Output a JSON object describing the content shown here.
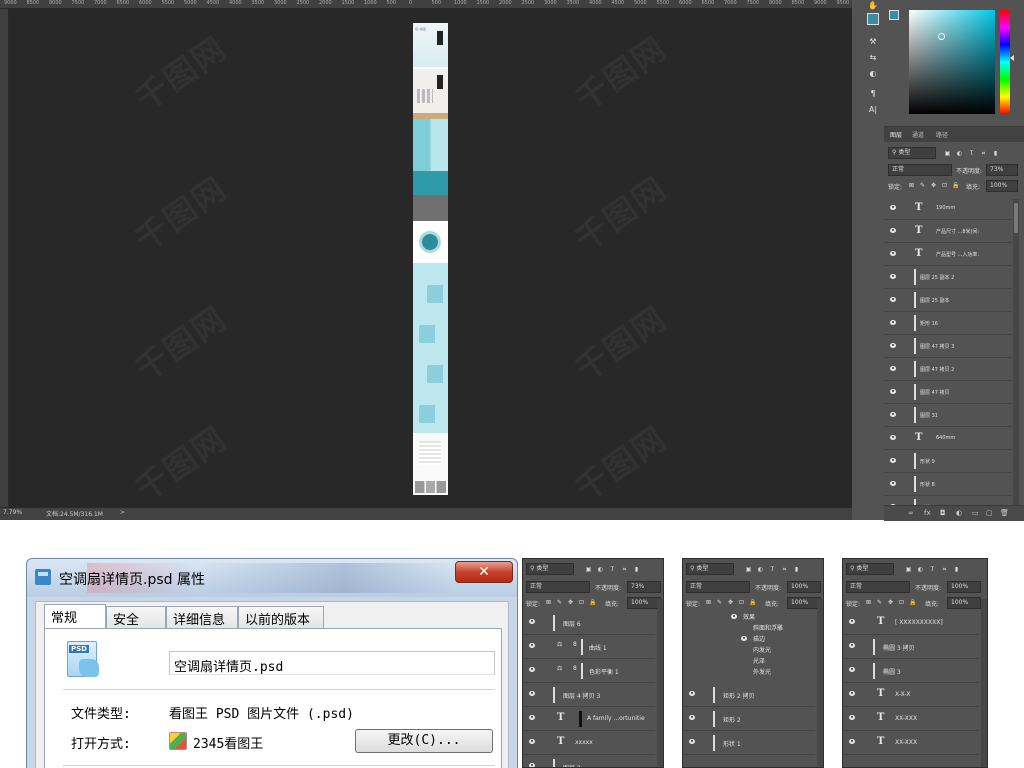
{
  "photoshop": {
    "ruler_ticks": [
      "9000",
      "8500",
      "8000",
      "7500",
      "7000",
      "6500",
      "6000",
      "5500",
      "5000",
      "4500",
      "4000",
      "3500",
      "3000",
      "2500",
      "2000",
      "1500",
      "1000",
      "500",
      "0",
      "500",
      "1000",
      "1500",
      "2000",
      "2500",
      "3000",
      "3500",
      "4000",
      "4500",
      "5000",
      "5500",
      "6000",
      "6500",
      "7000",
      "7500",
      "8000",
      "8500",
      "9000",
      "9500"
    ],
    "status": {
      "zoom": "7.79%",
      "doc_info": "文档:24.5M/316.1M",
      "arrow": ">"
    },
    "watermark": "千图网",
    "document": {
      "text_samples": [
        "色•恒温",
        "品牌介绍",
        "产品展示"
      ]
    },
    "tool_icons": [
      "hand-tool-icon",
      "swatch-icon",
      "brush-adjust-icon",
      "settings-icon",
      "drop-icon",
      "paragraph-icon",
      "character-icon"
    ],
    "tool_glyphs": [
      "✋",
      "",
      "⚒",
      "⇆",
      "◐",
      "¶",
      "A|"
    ],
    "color": {
      "foreground": "#3b8da3",
      "background": "#ffffff"
    },
    "layers_panel": {
      "tabs": [
        "图层",
        "通道",
        "路径"
      ],
      "filter_label": "类型",
      "blend_mode": "正常",
      "opacity_label": "不透明度:",
      "opacity_value": "73%",
      "lock_label": "锁定:",
      "fill_label": "填充:",
      "fill_value": "100%",
      "filter_icons": [
        "▣",
        "◐",
        "T",
        "⌗",
        "▮"
      ],
      "lock_icons": [
        "⊠",
        "✎",
        "✥",
        "⊡",
        "🔒"
      ],
      "rows": [
        {
          "type": "text",
          "name": "190mm"
        },
        {
          "type": "text",
          "name": "产品尺寸 ...8米)间:"
        },
        {
          "type": "text",
          "name": "产品型号 ...入功率:"
        },
        {
          "type": "shape",
          "name": "图层 25 副本 2"
        },
        {
          "type": "shape",
          "name": "图层 25 副本"
        },
        {
          "type": "shape",
          "name": "矩形 16"
        },
        {
          "type": "shape",
          "name": "图层 47 拷贝 3"
        },
        {
          "type": "shape",
          "name": "图层 47 拷贝 2"
        },
        {
          "type": "shape",
          "name": "图层 47 拷贝"
        },
        {
          "type": "shape",
          "name": "图层 31"
        },
        {
          "type": "text",
          "name": "640mm"
        },
        {
          "type": "shape",
          "name": "形状 9"
        },
        {
          "type": "shape",
          "name": "形状 8"
        },
        {
          "type": "shape",
          "name": "形状 7"
        }
      ],
      "footer_icons": [
        "∞",
        "fx",
        "◘",
        "◐",
        "▭",
        "▢",
        "🗑"
      ]
    }
  },
  "properties_dialog": {
    "title": "空调扇详情页.psd 属性",
    "close_glyph": "✕",
    "tabs": [
      "常规",
      "安全",
      "详细信息",
      "以前的版本"
    ],
    "active_tab": 0,
    "icon_label": "PSD",
    "filename": "空调扇详情页.psd",
    "file_type_label": "文件类型:",
    "file_type_value": "看图王 PSD 图片文件 (.psd)",
    "open_with_label": "打开方式:",
    "open_with_value": "2345看图王",
    "change_button": "更改(C)..."
  },
  "mini_panels": [
    {
      "filter_label": "类型",
      "blend_mode": "正常",
      "opacity_label": "不透明度:",
      "opacity_value": "73%",
      "lock_label": "锁定:",
      "fill_label": "填充:",
      "fill_value": "100%",
      "rows": [
        {
          "type": "shape",
          "name": "图层 6"
        },
        {
          "type": "adjust",
          "name": "曲线 1"
        },
        {
          "type": "adjust",
          "name": "色彩平衡 1"
        },
        {
          "type": "shape",
          "name": "图层 4 拷贝 3"
        },
        {
          "type": "textmask",
          "name": "A family ...ortunitie"
        },
        {
          "type": "text",
          "name": "xxxxx"
        },
        {
          "type": "shape",
          "name": "图层 2"
        }
      ]
    },
    {
      "filter_label": "类型",
      "blend_mode": "正常",
      "opacity_label": "不透明度:",
      "opacity_value": "100%",
      "lock_label": "锁定:",
      "fill_label": "填充:",
      "fill_value": "100%",
      "effects": [
        "效果",
        "斜面和浮雕",
        "描边",
        "内发光",
        "光泽",
        "外发光"
      ],
      "rows": [
        {
          "type": "shape",
          "name": "矩形 2 拷贝"
        },
        {
          "type": "shape",
          "name": "矩形 2"
        },
        {
          "type": "shape",
          "name": "形状 1"
        }
      ]
    },
    {
      "filter_label": "类型",
      "blend_mode": "正常",
      "opacity_label": "不透明度:",
      "opacity_value": "100%",
      "lock_label": "锁定:",
      "fill_label": "填充:",
      "fill_value": "100%",
      "rows": [
        {
          "type": "text",
          "name": "[ XXXXXXXXXX]"
        },
        {
          "type": "shape",
          "name": "椭圆 3 拷贝"
        },
        {
          "type": "shape",
          "name": "椭圆 3"
        },
        {
          "type": "text",
          "name": "X-X-X"
        },
        {
          "type": "text",
          "name": "XX-XXX"
        },
        {
          "type": "text",
          "name": "XX-XXX"
        }
      ]
    }
  ]
}
